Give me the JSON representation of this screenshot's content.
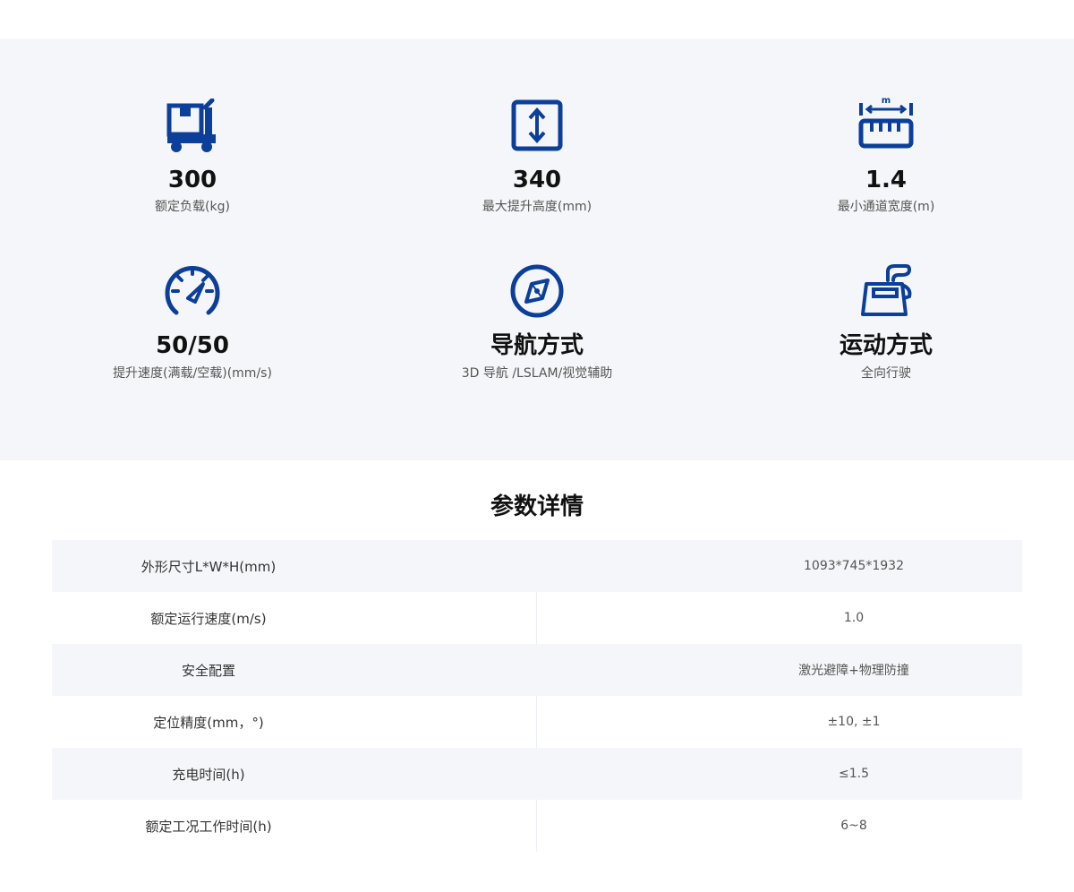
{
  "features": [
    {
      "icon": "cart-icon",
      "value": "300",
      "label": "额定负载(kg)"
    },
    {
      "icon": "height-arrow-icon",
      "value": "340",
      "label": "最大提升高度(mm)"
    },
    {
      "icon": "ruler-icon",
      "value": "1.4",
      "label": "最小通道宽度(m)"
    },
    {
      "icon": "speedometer-icon",
      "value": "50/50",
      "label": "提升速度(满载/空载)(mm/s)"
    },
    {
      "icon": "compass-icon",
      "value": "导航方式",
      "label": "3D 导航 /LSLAM/视觉辅助"
    },
    {
      "icon": "motion-icon",
      "value": "运动方式",
      "label": "全向行驶"
    }
  ],
  "section_title": "参数详情",
  "specs": [
    {
      "key": "外形尺寸L*W*H(mm)",
      "value": "1093*745*1932"
    },
    {
      "key": "额定运行速度(m/s)",
      "value": "1.0"
    },
    {
      "key": "安全配置",
      "value": "激光避障+物理防撞"
    },
    {
      "key": "定位精度(mm，°)",
      "value": "±10, ±1"
    },
    {
      "key": "充电时间(h)",
      "value": "≤1.5"
    },
    {
      "key": "额定工况工作时间(h)",
      "value": "6~8"
    }
  ],
  "accent_color": "#0b3f9a"
}
